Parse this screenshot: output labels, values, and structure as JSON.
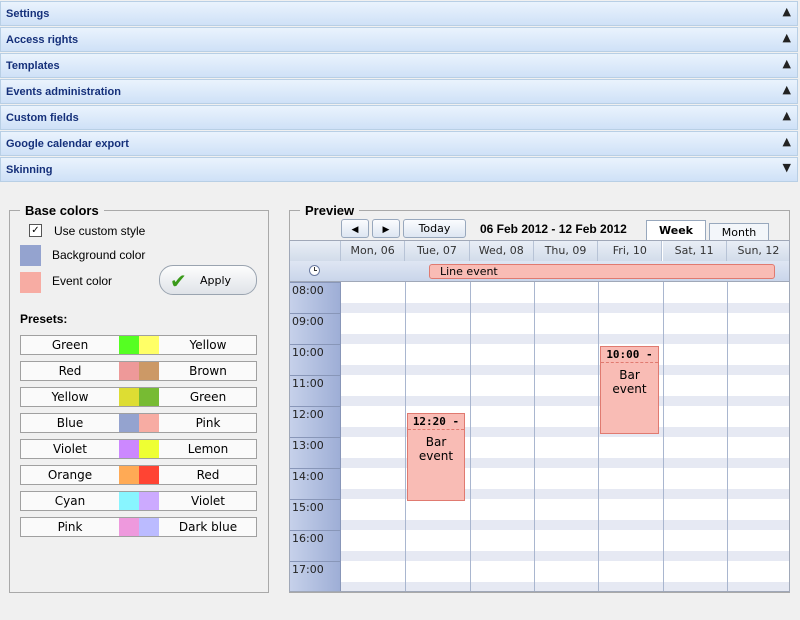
{
  "accordion": [
    {
      "label": "Settings",
      "chevron": "▲"
    },
    {
      "label": "Access rights",
      "chevron": "▲"
    },
    {
      "label": "Templates",
      "chevron": "▲"
    },
    {
      "label": "Events administration",
      "chevron": "▲"
    },
    {
      "label": "Custom fields",
      "chevron": "▲"
    },
    {
      "label": "Google calendar export",
      "chevron": "▲"
    },
    {
      "label": "Skinning",
      "chevron": "▼"
    }
  ],
  "base_colors": {
    "legend": "Base colors",
    "use_custom_label": "Use custom style",
    "use_custom_checked": "✓",
    "background_label": "Background color",
    "background_color": "#94a3cf",
    "event_label": "Event color",
    "event_color": "#f7aca3",
    "apply_label": "Apply",
    "presets_label": "Presets:"
  },
  "presets": [
    {
      "name1": "Green",
      "color1": "#55ff22",
      "color2": "#ffff66",
      "name2": "Yellow"
    },
    {
      "name1": "Red",
      "color1": "#ee9999",
      "color2": "#cc9966",
      "name2": "Brown"
    },
    {
      "name1": "Yellow",
      "color1": "#dddd33",
      "color2": "#77bb33",
      "name2": "Green"
    },
    {
      "name1": "Blue",
      "color1": "#94a3cf",
      "color2": "#f7aca3",
      "name2": "Pink"
    },
    {
      "name1": "Violet",
      "color1": "#cc88ff",
      "color2": "#eeff33",
      "name2": "Lemon"
    },
    {
      "name1": "Orange",
      "color1": "#ffaa55",
      "color2": "#ff4433",
      "name2": "Red"
    },
    {
      "name1": "Cyan",
      "color1": "#88f5ff",
      "color2": "#ccaaff",
      "name2": "Violet"
    },
    {
      "name1": "Pink",
      "color1": "#ee99dd",
      "color2": "#bbbbff",
      "name2": "Dark blue"
    }
  ],
  "preview": {
    "legend": "Preview",
    "prev_icon": "◀",
    "next_icon": "▶",
    "today_label": "Today",
    "date_range": "06 Feb 2012 - 12 Feb 2012",
    "tab_week": "Week",
    "tab_month": "Month",
    "days": [
      "Mon, 06",
      "Tue, 07",
      "Wed, 08",
      "Thu, 09",
      "Fri, 10",
      "Sat, 11",
      "Sun, 12"
    ],
    "line_event": "Line event",
    "clock_icon": "clock-icon",
    "hours": [
      "08:00",
      "09:00",
      "10:00",
      "11:00",
      "12:00",
      "13:00",
      "14:00",
      "15:00",
      "16:00",
      "17:00"
    ],
    "events": [
      {
        "time": "12:20 -",
        "text": "Bar event"
      },
      {
        "time": "10:00 -",
        "text": "Bar event"
      }
    ]
  }
}
